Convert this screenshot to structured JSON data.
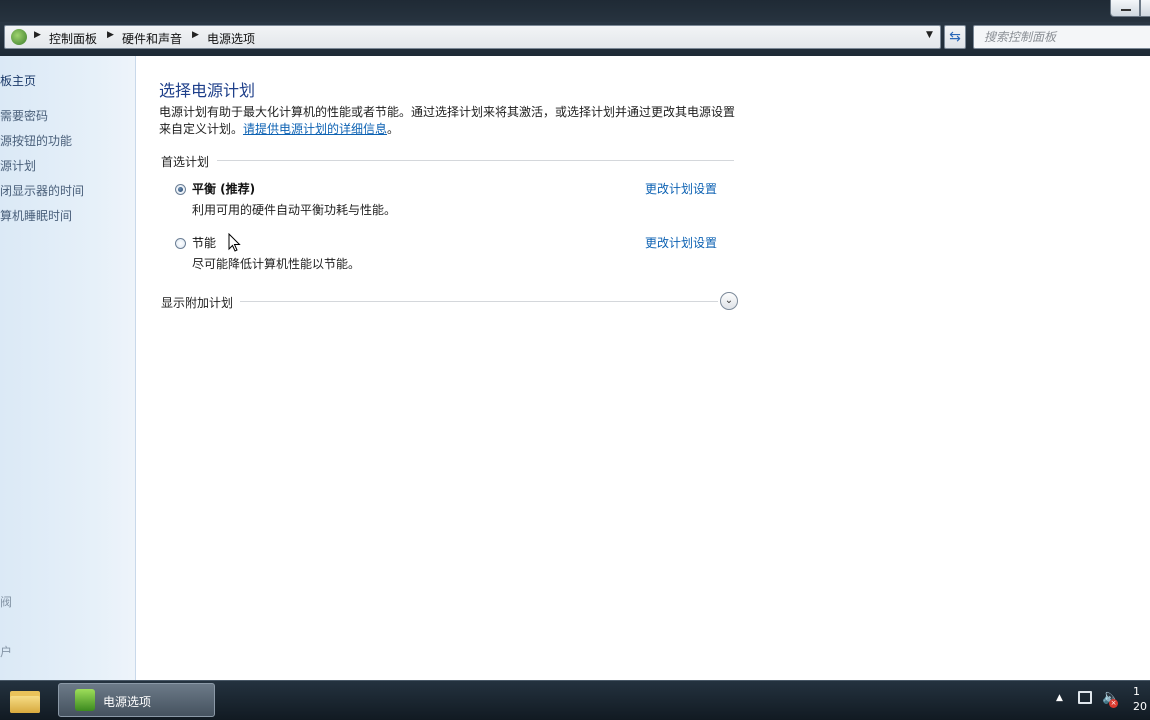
{
  "window": {
    "title_controls": [
      "minimize",
      "maximize"
    ]
  },
  "address_bar": {
    "breadcrumbs": [
      "控制面板",
      "硬件和声音",
      "电源选项"
    ],
    "search_placeholder": "搜索控制面板"
  },
  "sidebar": {
    "home": "板主页",
    "links": [
      "需要密码",
      "源按钮的功能",
      "源计划",
      "闭显示器的时间",
      "算机睡眠时间"
    ],
    "see_also": [
      "阀",
      "户"
    ]
  },
  "main": {
    "title": "选择电源计划",
    "description_line1": "电源计划有助于最大化计算机的性能或者节能。通过选择计划来将其激活，或选择计划并通过更改其电源设置",
    "description_line2_prefix": "来自定义计划。",
    "description_link": "请提供电源计划的详细信息",
    "description_suffix": "。",
    "preferred_group": "首选计划",
    "plans": [
      {
        "name": "平衡 (推荐)",
        "desc": "利用可用的硬件自动平衡功耗与性能。",
        "selected": true,
        "change_label": "更改计划设置"
      },
      {
        "name": "节能",
        "desc": "尽可能降低计算机性能以节能。",
        "selected": false,
        "change_label": "更改计划设置"
      }
    ],
    "show_more": "显示附加计划"
  },
  "taskbar": {
    "active_task": "电源选项",
    "clock_line1": "1",
    "clock_line2": "20"
  },
  "colors": {
    "link": "#0d62b3",
    "title": "#1e3f8a",
    "sidebar_bg": "#dbe9f6",
    "taskbar_bg": "#1a2530"
  },
  "icons": [
    "control-panel-icon",
    "refresh-icon",
    "chevron-down-icon",
    "folder-icon",
    "power-options-icon",
    "network-icon",
    "volume-muted-icon",
    "mouse-cursor-icon"
  ]
}
